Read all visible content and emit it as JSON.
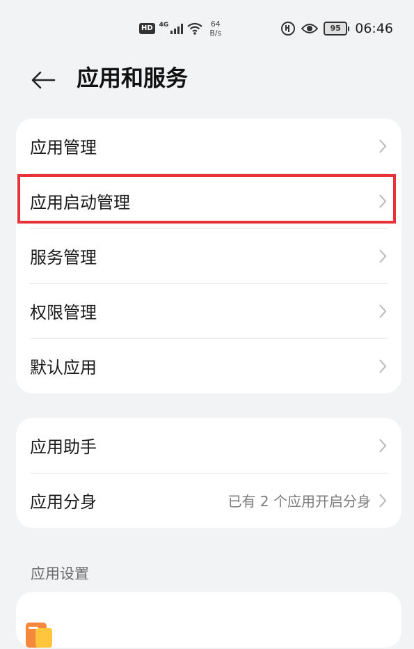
{
  "status_bar": {
    "hd": "HD",
    "network": "4G",
    "speed_value": "64",
    "speed_unit": "B/s",
    "battery": "95",
    "time": "06:46"
  },
  "header": {
    "title": "应用和服务"
  },
  "group1": {
    "items": [
      {
        "label": "应用管理"
      },
      {
        "label": "应用启动管理"
      },
      {
        "label": "服务管理"
      },
      {
        "label": "权限管理"
      },
      {
        "label": "默认应用"
      }
    ]
  },
  "group2": {
    "items": [
      {
        "label": "应用助手",
        "value": ""
      },
      {
        "label": "应用分身",
        "value": "已有 2 个应用开启分身"
      }
    ]
  },
  "section": {
    "title": "应用设置"
  },
  "colors": {
    "highlight": "#e8323a",
    "background": "#f1f3f5",
    "card": "#ffffff"
  }
}
